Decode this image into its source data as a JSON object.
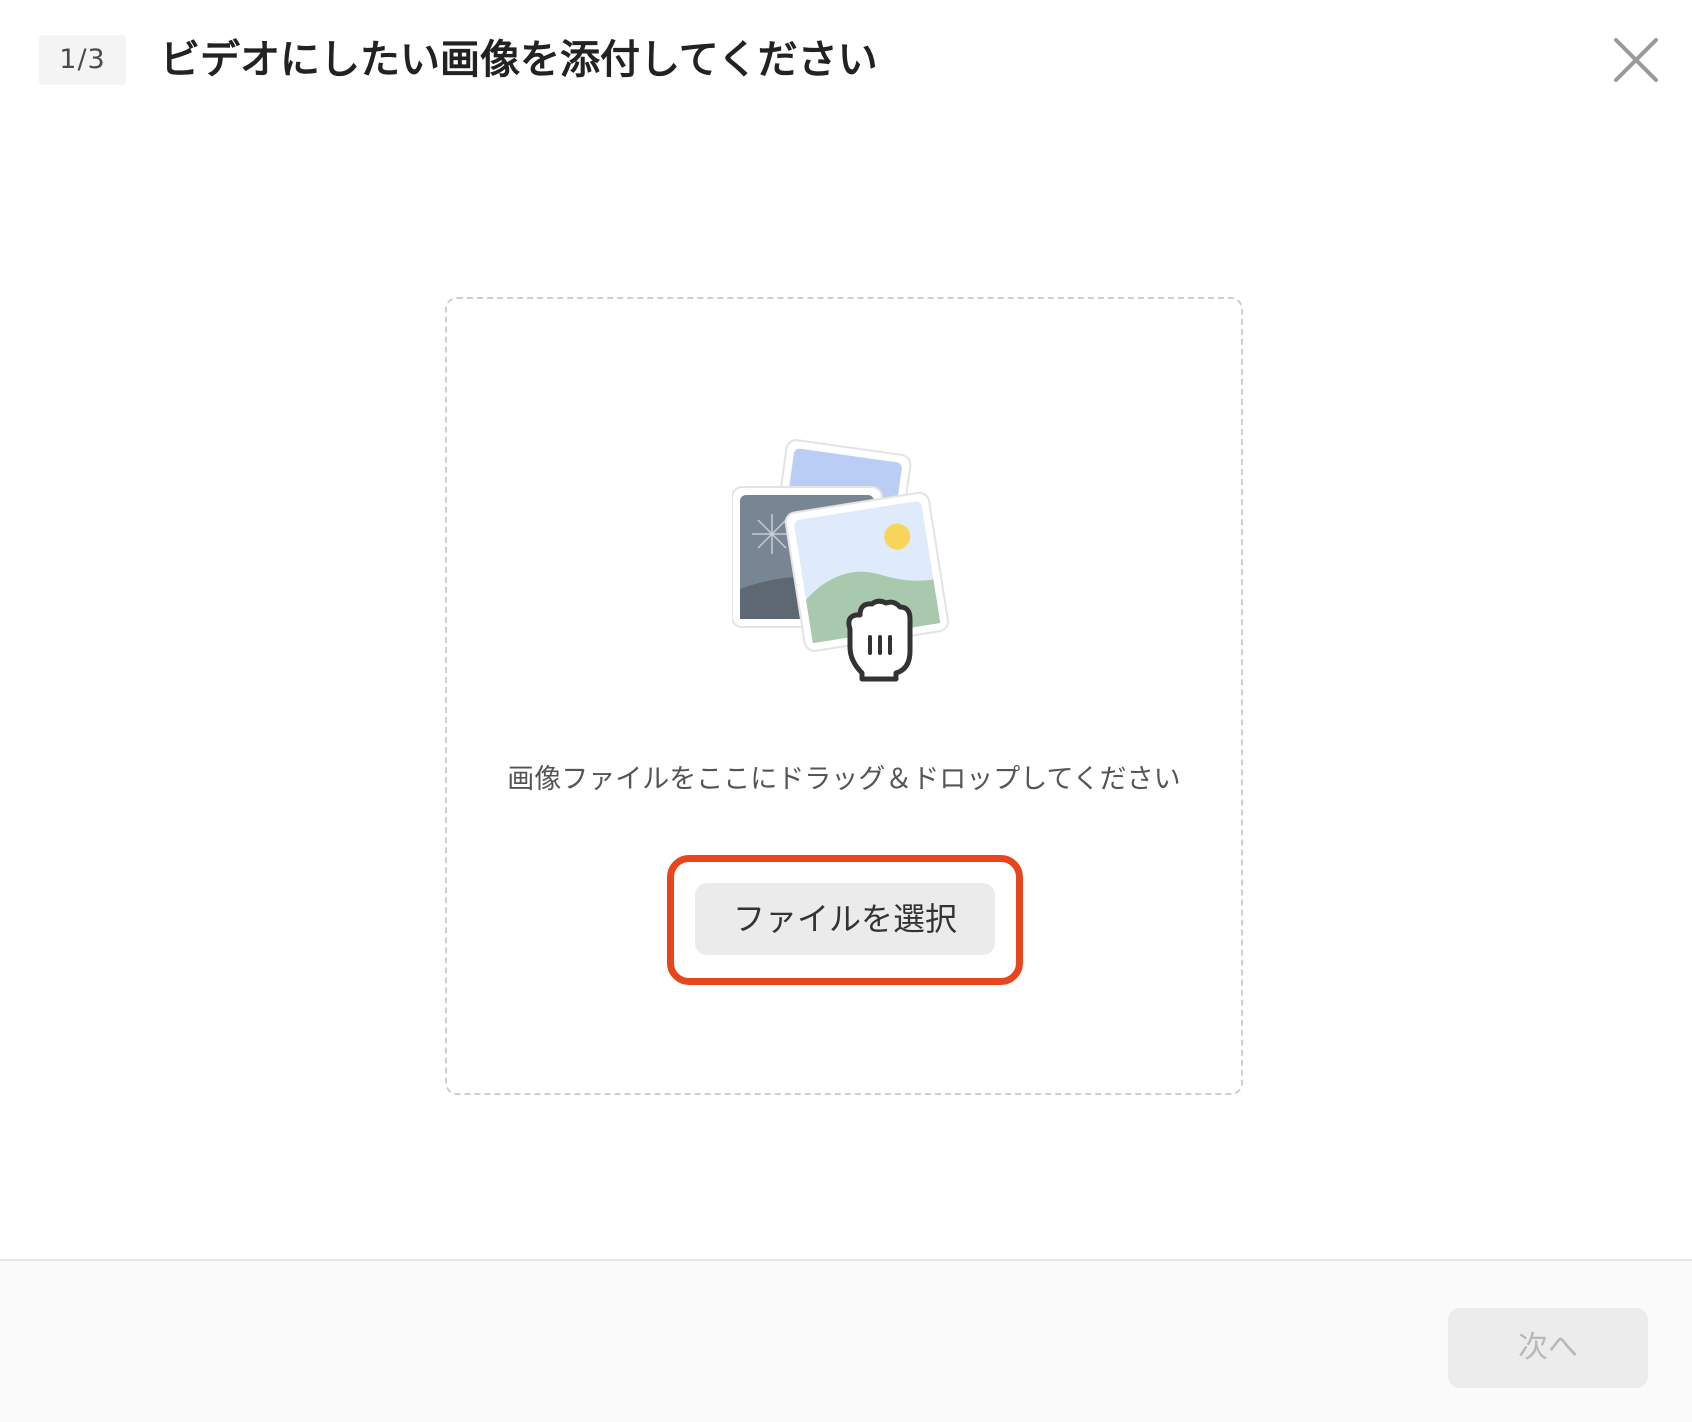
{
  "header": {
    "step_indicator": "1/3",
    "title": "ビデオにしたい画像を添付してください",
    "close_icon": "close-icon"
  },
  "dropzone": {
    "illustration_icon": "image-stack-with-grab-hand-icon",
    "hint": "画像ファイルをここにドラッグ＆ドロップしてください",
    "select_button_label": "ファイルを選択",
    "highlight_color": "#e8451f"
  },
  "footer": {
    "next_button_label": "次へ",
    "next_button_enabled": false
  }
}
